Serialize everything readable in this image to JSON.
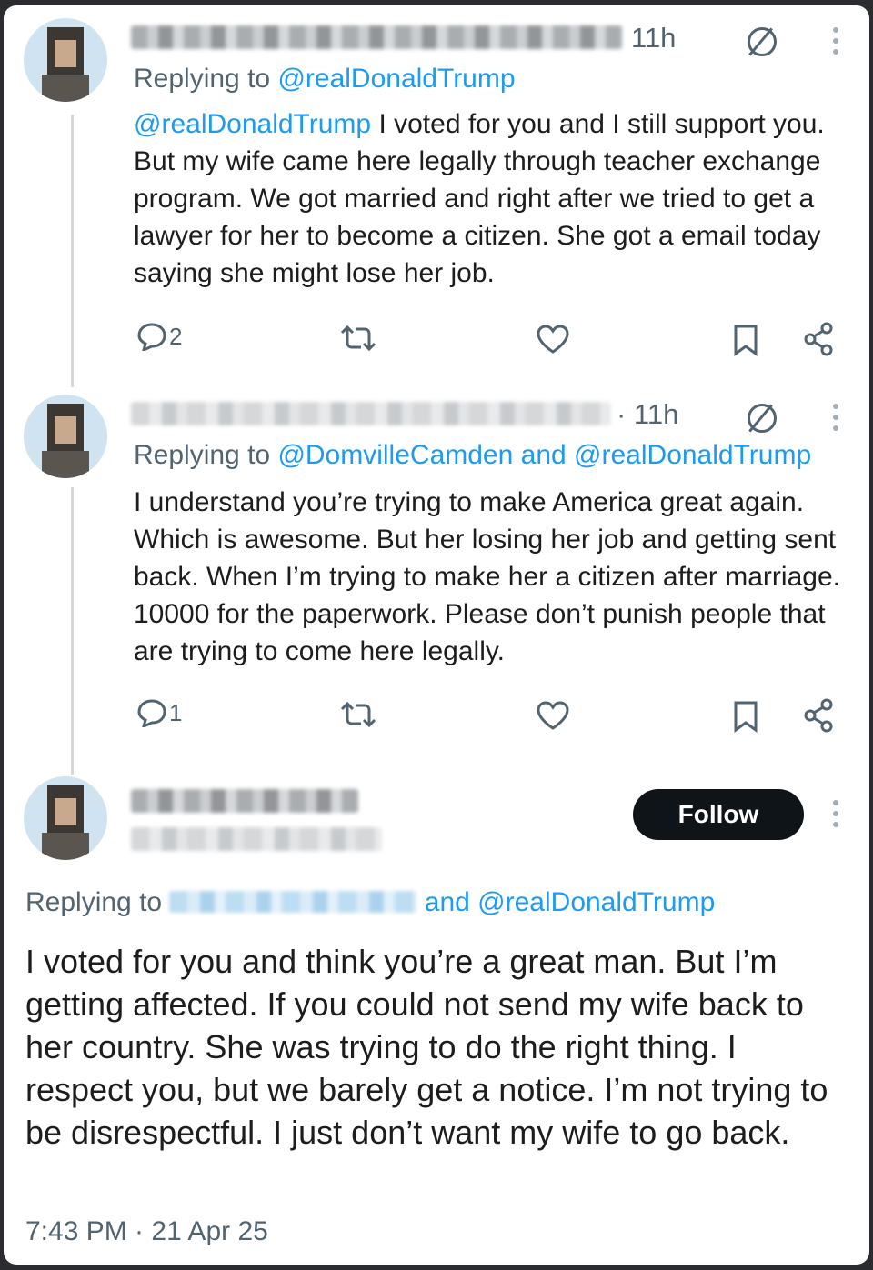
{
  "tweet1": {
    "time": "11h",
    "reply_prefix": "Replying to ",
    "reply_handle": "@realDonaldTrump",
    "body_mention": "@realDonaldTrump",
    "body": " I voted for you and I still support you. But my wife came here legally through teacher exchange program. We got married and right after we tried to get a lawyer for her to become a citizen. She got a email today saying she might lose her job.",
    "reply_count": "2",
    "retweet_count": "",
    "like_count": ""
  },
  "tweet2": {
    "time": "· 11h",
    "reply_prefix": "Replying to ",
    "reply_handle_1": "@DomvilleCamden",
    "reply_and": " and ",
    "reply_handle_2": "@realDonaldTrump",
    "body": "I understand you’re trying to make America great again. Which is awesome. But her losing her job and getting sent back. When I’m trying to make her a citizen after marriage. 10000 for the paperwork. Please don’t punish people that are trying to come here legally.",
    "reply_count": "1"
  },
  "main_tweet": {
    "follow_label": "Follow",
    "reply_prefix": "Replying to ",
    "reply_and": "and ",
    "reply_handle": "@realDonaldTrump",
    "body": "I voted for you and think you’re a great man. But I’m getting affected. If you could not send my wife back to her country. She was trying to do the right thing. I respect you, but we barely get a notice. I’m not trying to be disrespectful. I just don’t want my wife to go back.",
    "timestamp": "7:43 PM · 21 Apr 25"
  },
  "colors": {
    "link": "#1d9bf0",
    "muted": "#536471",
    "follow_bg": "#0f1419"
  },
  "icons": [
    "reply-icon",
    "retweet-icon",
    "like-icon",
    "bookmark-icon",
    "share-icon",
    "grok-icon",
    "more-icon"
  ]
}
